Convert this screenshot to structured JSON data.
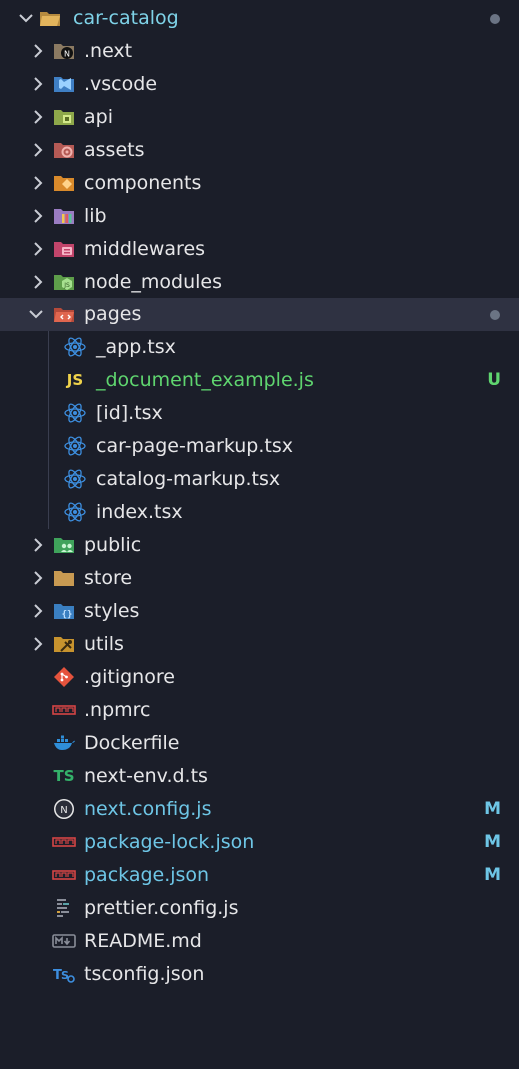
{
  "root": {
    "label": "car-catalog",
    "label_color": "#7fd3e8"
  },
  "folders": [
    {
      "label": ".next",
      "icon": "nextjs-folder-icon"
    },
    {
      "label": ".vscode",
      "icon": "vscode-folder-icon"
    },
    {
      "label": "api",
      "icon": "api-folder-icon"
    },
    {
      "label": "assets",
      "icon": "assets-folder-icon"
    },
    {
      "label": "components",
      "icon": "components-folder-icon"
    },
    {
      "label": "lib",
      "icon": "lib-folder-icon"
    },
    {
      "label": "middlewares",
      "icon": "middleware-folder-icon"
    },
    {
      "label": "node_modules",
      "icon": "node-folder-icon"
    }
  ],
  "pages_folder": {
    "label": "pages",
    "icon": "views-folder-open-icon"
  },
  "pages_files": [
    {
      "label": "_app.tsx",
      "icon": "react-icon",
      "status": ""
    },
    {
      "label": "_document_example.js",
      "icon": "javascript-icon",
      "status": "U"
    },
    {
      "label": "[id].tsx",
      "icon": "react-icon",
      "status": ""
    },
    {
      "label": "car-page-markup.tsx",
      "icon": "react-icon",
      "status": ""
    },
    {
      "label": "catalog-markup.tsx",
      "icon": "react-icon",
      "status": ""
    },
    {
      "label": "index.tsx",
      "icon": "react-icon",
      "status": ""
    }
  ],
  "folders_after": [
    {
      "label": "public",
      "icon": "public-folder-icon"
    },
    {
      "label": "store",
      "icon": "folder-icon"
    },
    {
      "label": "styles",
      "icon": "styles-folder-icon"
    },
    {
      "label": "utils",
      "icon": "utils-folder-icon"
    }
  ],
  "root_files": [
    {
      "label": ".gitignore",
      "icon": "git-icon",
      "status": ""
    },
    {
      "label": ".npmrc",
      "icon": "npm-icon",
      "status": ""
    },
    {
      "label": "Dockerfile",
      "icon": "docker-icon",
      "status": ""
    },
    {
      "label": "next-env.d.ts",
      "icon": "typescript-icon",
      "status": ""
    },
    {
      "label": "next.config.js",
      "icon": "nextjs-icon",
      "status": "M"
    },
    {
      "label": "package-lock.json",
      "icon": "npm-icon",
      "status": "M"
    },
    {
      "label": "package.json",
      "icon": "npm-icon",
      "status": "M"
    },
    {
      "label": "prettier.config.js",
      "icon": "prettier-icon",
      "status": ""
    },
    {
      "label": "README.md",
      "icon": "markdown-icon",
      "status": ""
    },
    {
      "label": "tsconfig.json",
      "icon": "tsconfig-icon",
      "status": ""
    }
  ],
  "colors": {
    "background": "#1b1e29",
    "selected_row": "#2f3242",
    "text": "#e6e6e8",
    "untracked": "#5fd56f",
    "modified": "#6ec6e6",
    "badge_dot": "#6b7484"
  }
}
